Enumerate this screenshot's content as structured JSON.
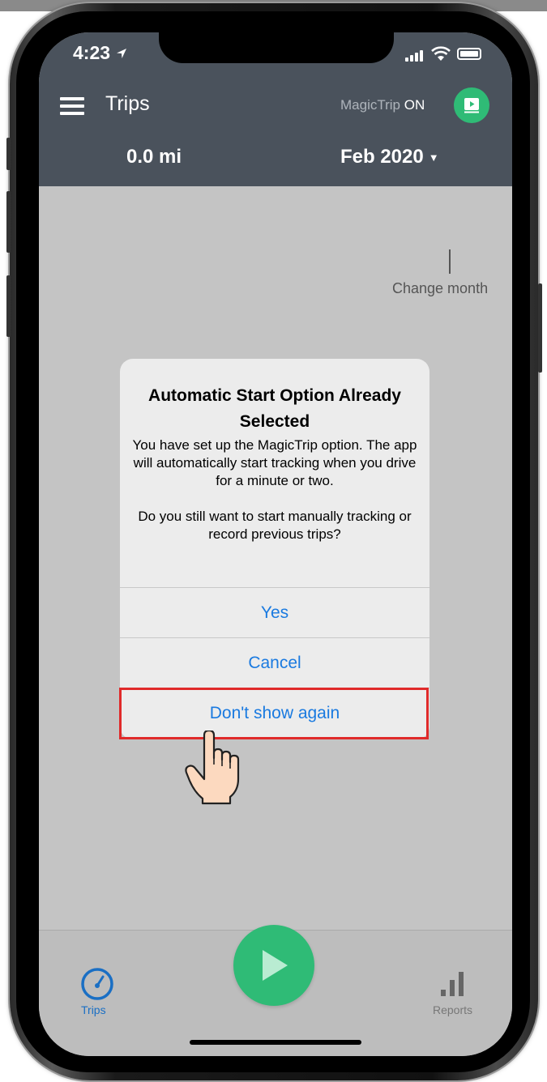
{
  "status": {
    "time": "4:23"
  },
  "header": {
    "title": "Trips",
    "magic_trip_label": "MagicTrip",
    "magic_trip_state": "ON",
    "distance": "0.0 mi",
    "month": "Feb 2020"
  },
  "hint": {
    "text": "Change month"
  },
  "dialog": {
    "title": "Automatic Start Option Already Selected",
    "message": "You have set up the MagicTrip option. The app will automatically start tracking when you drive for a minute or two.\n\nDo you still want to start manually tracking or record previous trips?",
    "buttons": {
      "yes": "Yes",
      "cancel": "Cancel",
      "dont_show": "Don't show again"
    }
  },
  "tabs": {
    "trips": "Trips",
    "reports": "Reports"
  },
  "colors": {
    "header_bg": "#4a525c",
    "accent_green": "#2fbb76",
    "link_blue": "#1a7ae0",
    "highlight_red": "#e02a2a"
  }
}
